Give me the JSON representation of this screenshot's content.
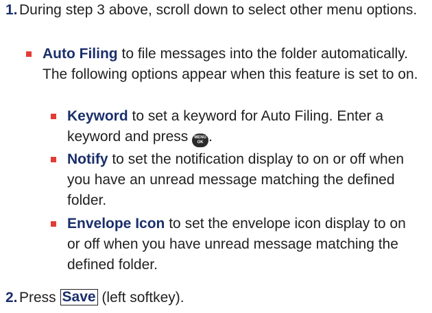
{
  "steps": [
    {
      "num": "1.",
      "text": "During step 3 above, scroll down to select other menu options."
    },
    {
      "num": "2.",
      "pre": "Press",
      "softkey": "Save",
      "post": "(left softkey)."
    }
  ],
  "auto_filing": {
    "term": "Auto Filing",
    "text": "to file messages into the folder automatically. The following options appear when this feature is set to on."
  },
  "sub_options": [
    {
      "term": "Keyword",
      "text": "to set a keyword for Auto Filing. Enter a keyword and press",
      "end": "."
    },
    {
      "term": "Notify",
      "text": "to set the notification display to on or off when you have an unread message matching the defined folder."
    },
    {
      "term": "Envelope Icon",
      "text": "to set the envelope icon display to on or off when you have unread message matching the defined folder."
    }
  ],
  "menu_key": {
    "icon": "menu-ok-key-icon",
    "line1": "MENU",
    "line2": "OK"
  },
  "colors": {
    "text": "#1f1f1f",
    "term": "#1a2f6b",
    "bullet": "#e23c35",
    "key": "#2a2a2a"
  }
}
